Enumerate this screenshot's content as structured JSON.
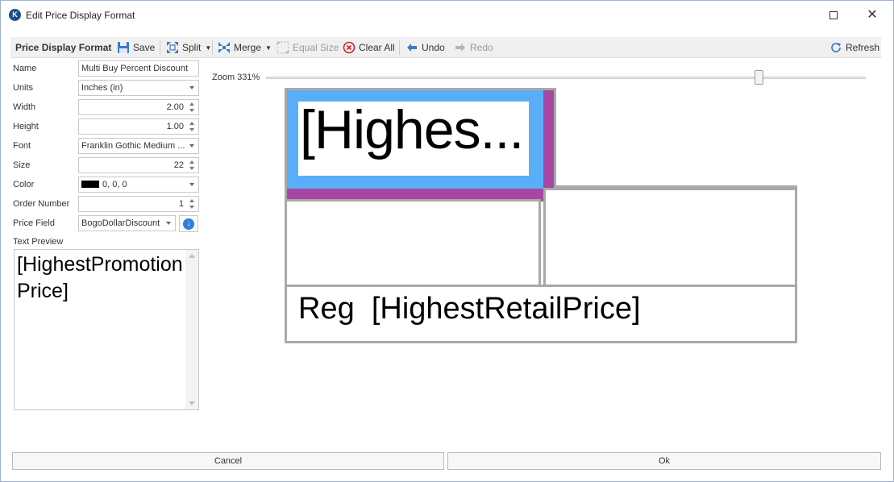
{
  "window": {
    "title": "Edit Price Display Format",
    "app_icon": "K"
  },
  "toolbar": {
    "title": "Price Display Format",
    "save": "Save",
    "split": "Split",
    "merge": "Merge",
    "equal_size": "Equal Size",
    "clear_all": "Clear All",
    "undo": "Undo",
    "redo": "Redo",
    "refresh": "Refresh"
  },
  "form": {
    "name_label": "Name",
    "name_value": "Multi Buy Percent Discount",
    "units_label": "Units",
    "units_value": "Inches (in)",
    "width_label": "Width",
    "width_value": "2.00",
    "height_label": "Height",
    "height_value": "1.00",
    "font_label": "Font",
    "font_value": "Franklin Gothic Medium ...",
    "size_label": "Size",
    "size_value": "22",
    "color_label": "Color",
    "color_value": "0, 0, 0",
    "color_swatch": "#000000",
    "order_label": "Order Number",
    "order_value": "1",
    "price_field_label": "Price Field",
    "price_field_value": "BogoDollarDiscount",
    "preview_label": "Text Preview",
    "preview_text": "[HighestPromotionPrice]"
  },
  "zoom": {
    "label": "Zoom 331%",
    "level": 331
  },
  "canvas": {
    "cell_selected_text": "[Highes...",
    "cell_bottom_text": "Reg  [HighestRetailPrice]",
    "selection_color": "#5aaef8",
    "merge_color": "#a747a3",
    "border_color": "#a9a9a9"
  },
  "footer": {
    "cancel": "Cancel",
    "ok": "Ok"
  }
}
